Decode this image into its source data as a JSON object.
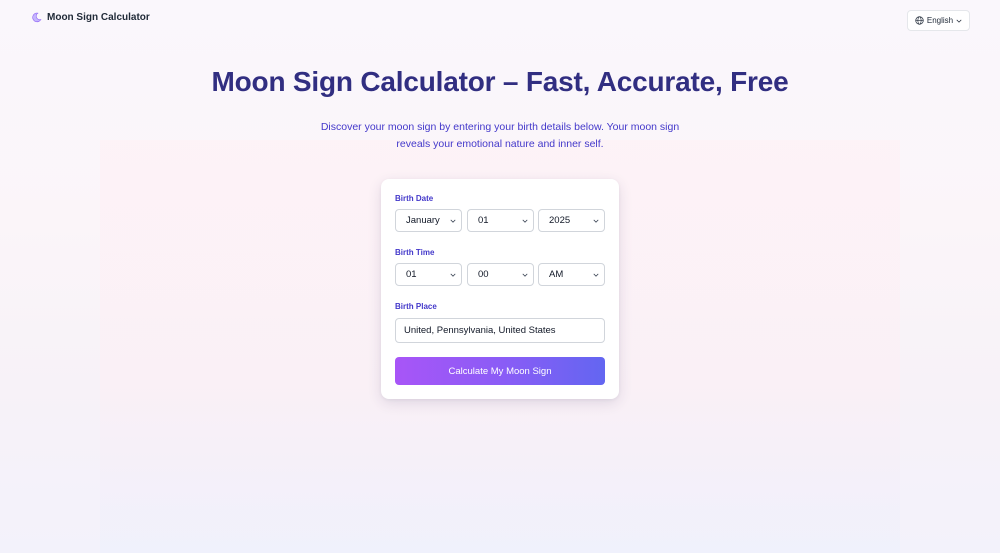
{
  "header": {
    "brand": "Moon Sign Calculator",
    "language": "English"
  },
  "hero": {
    "title": "Moon Sign Calculator – Fast, Accurate, Free",
    "subtitle_line1": "Discover your moon sign by entering your birth details below. Your moon sign",
    "subtitle_line2": "reveals your emotional nature and inner self."
  },
  "form": {
    "birth_date": {
      "label": "Birth Date",
      "month": "January",
      "day": "01",
      "year": "2025"
    },
    "birth_time": {
      "label": "Birth Time",
      "hour": "01",
      "minute": "00",
      "period": "AM"
    },
    "birth_place": {
      "label": "Birth Place",
      "value": "United, Pennsylvania, United States"
    },
    "submit_label": "Calculate My Moon Sign"
  },
  "icons": {
    "brand": "moon-icon",
    "language": "globe-icon",
    "dropdown": "chevron-down-icon"
  },
  "colors": {
    "title": "#312e81",
    "accent_start": "#a855f7",
    "accent_end": "#6366f1"
  }
}
